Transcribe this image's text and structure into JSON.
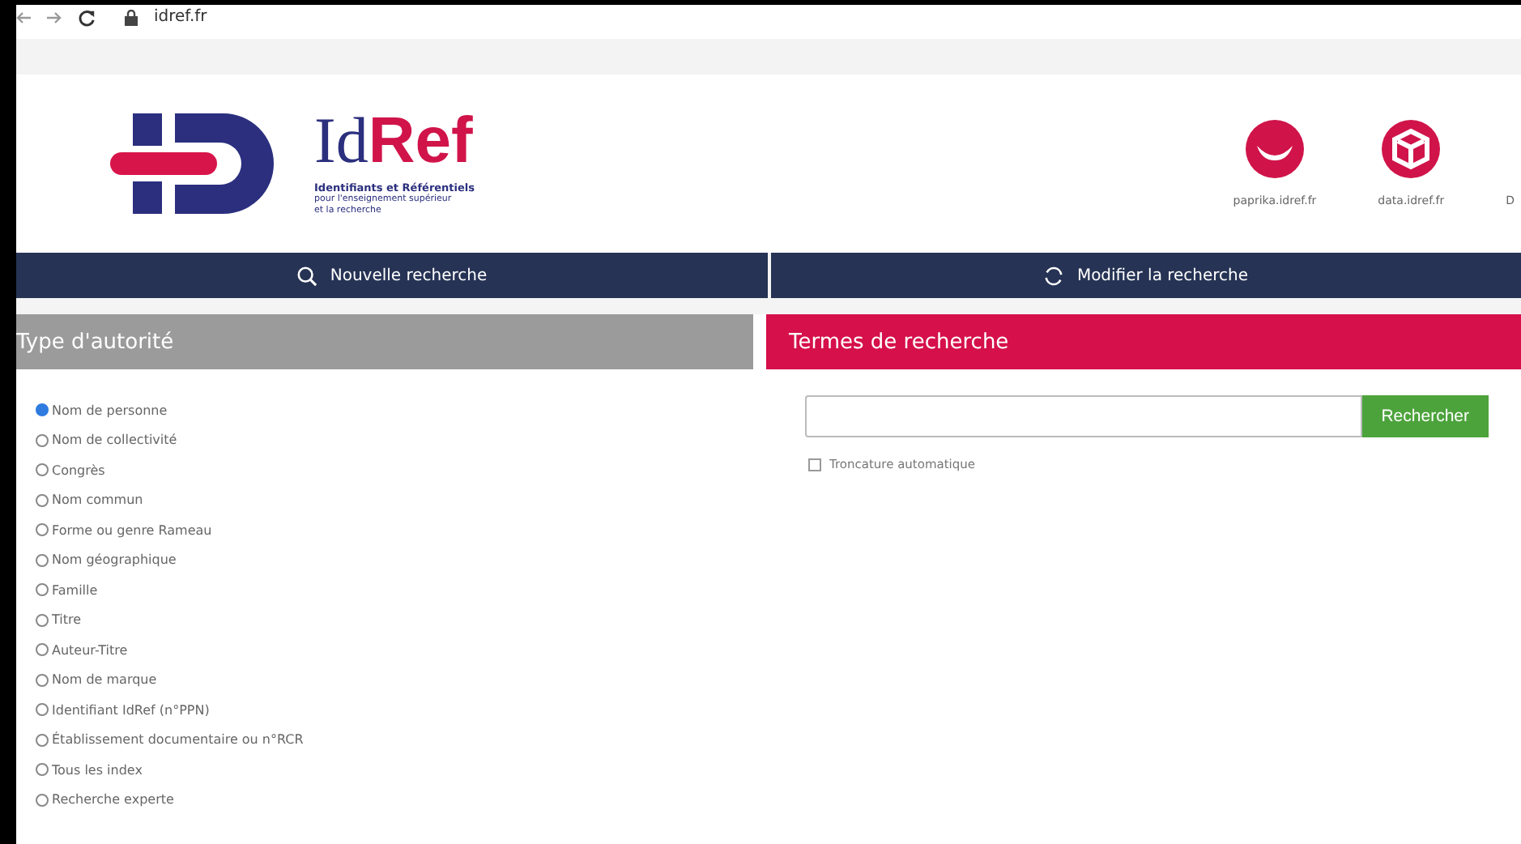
{
  "browser": {
    "address": "idref.fr"
  },
  "logo": {
    "word_1": "Id",
    "word_2": "Ref",
    "tagline": [
      "Identifiants et Référentiels",
      "pour l'enseignement supérieur",
      "et la recherche"
    ]
  },
  "header_links": [
    {
      "label": "paprika.idref.fr",
      "kind": "smile"
    },
    {
      "label": "data.idref.fr",
      "kind": "cube"
    },
    {
      "label": "D",
      "kind": "none"
    }
  ],
  "nav": [
    {
      "label": "Nouvelle recherche",
      "kind": "search"
    },
    {
      "label": "Modifier la recherche",
      "kind": "refresh"
    }
  ],
  "authority_panel": {
    "title": "Type d'autorité",
    "options": [
      {
        "label": "Nom de personne",
        "selected": true
      },
      {
        "label": "Nom de collectivité",
        "selected": false
      },
      {
        "label": "Congrès",
        "selected": false
      },
      {
        "label": "Nom commun",
        "selected": false
      },
      {
        "label": "Forme ou genre Rameau",
        "selected": false
      },
      {
        "label": "Nom géographique",
        "selected": false
      },
      {
        "label": "Famille",
        "selected": false
      },
      {
        "label": "Titre",
        "selected": false
      },
      {
        "label": "Auteur-Titre",
        "selected": false
      },
      {
        "label": "Nom de marque",
        "selected": false
      },
      {
        "label": "Identifiant IdRef (n°PPN)",
        "selected": false
      },
      {
        "label": "Établissement documentaire ou n°RCR",
        "selected": false
      },
      {
        "label": "Tous les index",
        "selected": false
      },
      {
        "label": "Recherche experte",
        "selected": false
      }
    ]
  },
  "search_panel": {
    "title": "Termes de recherche",
    "button": "Rechercher",
    "truncation": {
      "label": "Troncature automatique",
      "checked": false
    }
  }
}
